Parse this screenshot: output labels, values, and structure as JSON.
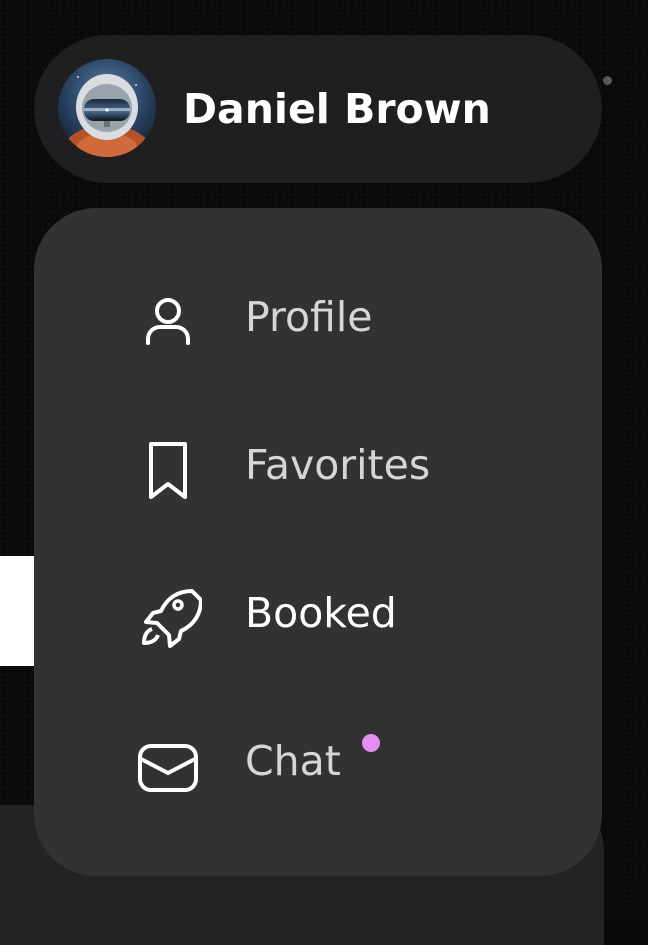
{
  "user": {
    "name": "Daniel Brown",
    "avatar_icon": "astronaut-avatar"
  },
  "menu": {
    "items": [
      {
        "label": "Profile",
        "icon": "user-icon",
        "active": false,
        "notification": false
      },
      {
        "label": "Favorites",
        "icon": "bookmark-icon",
        "active": false,
        "notification": false
      },
      {
        "label": "Booked",
        "icon": "rocket-icon",
        "active": true,
        "notification": false
      },
      {
        "label": "Chat",
        "icon": "mail-icon",
        "active": false,
        "notification": true
      }
    ]
  },
  "colors": {
    "background": "#0a0a0a",
    "pill": "#1f1f21",
    "menu": "#323232",
    "text_muted": "#d6d6d6",
    "text_active": "#ffffff",
    "notification": "#e38ef0"
  }
}
